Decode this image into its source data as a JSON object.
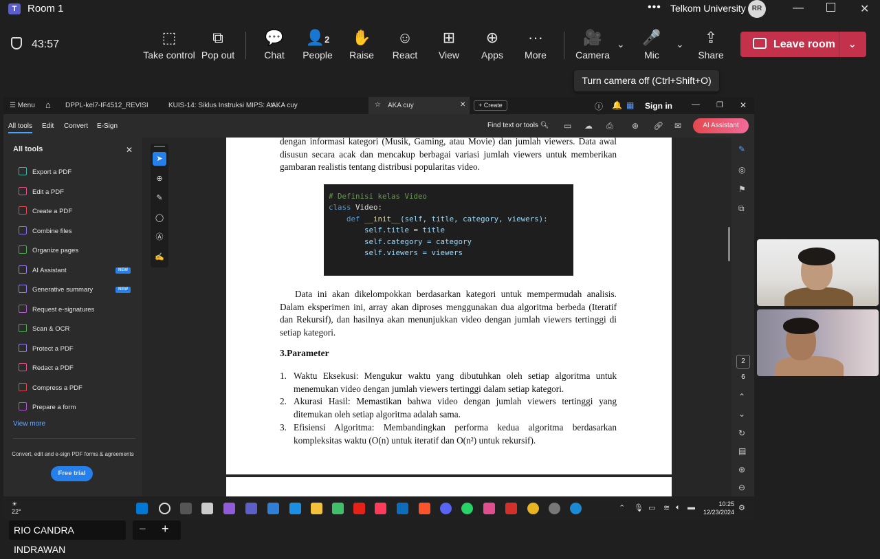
{
  "teams": {
    "window_title": "Room 1",
    "org_name": "Telkom University",
    "avatar_initials": "RR",
    "timer": "43:57",
    "toolbar": {
      "take_control": "Take control",
      "pop_out": "Pop out",
      "chat": "Chat",
      "people": "People",
      "people_count": "2",
      "raise": "Raise",
      "react": "React",
      "view": "View",
      "apps": "Apps",
      "more": "More",
      "camera": "Camera",
      "mic": "Mic",
      "share": "Share",
      "leave": "Leave room"
    },
    "tooltip": "Turn camera off (Ctrl+Shift+O)",
    "presenter_name": "RIO CANDRA INDRAWAN",
    "zoom_minus": "−",
    "zoom_plus": "+"
  },
  "acrobat": {
    "menu_label": "Menu",
    "tabs": [
      "DPPL-kel7-IF4512_REVISI",
      "KUIS-14: Siklus Instruksi MIPS: At...",
      "AKA cuy"
    ],
    "active_tab": "AKA cuy",
    "create_label": "+ Create",
    "sign_in": "Sign in",
    "menubar": {
      "all_tools": "All tools",
      "edit": "Edit",
      "convert": "Convert",
      "esign": "E-Sign",
      "find": "Find text or tools",
      "ai_assistant": "AI Assistant"
    },
    "panel": {
      "title": "All tools",
      "items": [
        {
          "label": "Export a PDF",
          "color": "#3fb8a7"
        },
        {
          "label": "Edit a PDF",
          "color": "#e8508c"
        },
        {
          "label": "Create a PDF",
          "color": "#e5484d"
        },
        {
          "label": "Combine files",
          "color": "#8c6cf0"
        },
        {
          "label": "Organize pages",
          "color": "#4caf50"
        },
        {
          "label": "AI Assistant",
          "color": "#9c7cf4",
          "badge": "NEW"
        },
        {
          "label": "Generative summary",
          "color": "#9c7cf4",
          "badge": "NEW"
        },
        {
          "label": "Request e-signatures",
          "color": "#b455d6"
        },
        {
          "label": "Scan & OCR",
          "color": "#4caf50"
        },
        {
          "label": "Protect a PDF",
          "color": "#9c7cf4"
        },
        {
          "label": "Redact a PDF",
          "color": "#e8508c"
        },
        {
          "label": "Compress a PDF",
          "color": "#e5484d"
        },
        {
          "label": "Prepare a form",
          "color": "#b455d6"
        }
      ],
      "view_more": "View more",
      "promo": "Convert, edit and e-sign PDF forms & agreements",
      "free_trial": "Free trial"
    },
    "document": {
      "intro_paragraph": "dengan informasi kategori (Musik, Gaming, atau Movie) dan jumlah viewers. Data awal disusun secara acak dan mencakup berbagai variasi jumlah viewers untuk memberikan gambaran realistis tentang distribusi popularitas video.",
      "code": {
        "comment": "# Definisi kelas Video",
        "line2_kw": "class",
        "line2_rest": " Video:",
        "line3_kw": "def",
        "line3_fn": "__init__",
        "line3_args": "(self, title, category, viewers):",
        "line4": "self.title = title",
        "line5": "self.category = category",
        "line6": "self.viewers = viewers"
      },
      "paragraph2": "Data ini akan dikelompokkan berdasarkan kategori untuk mempermudah analisis. Dalam eksperimen ini, array akan diproses menggunakan dua algoritma berbeda (Iteratif dan Rekursif), dan hasilnya akan menunjukkan video dengan jumlah viewers tertinggi di setiap kategori.",
      "heading": "3.Parameter",
      "list": [
        {
          "num": "1.",
          "text": "Waktu Eksekusi: Mengukur waktu yang dibutuhkan oleh setiap algoritma untuk menemukan video dengan jumlah viewers tertinggi dalam setiap kategori."
        },
        {
          "num": "2.",
          "text": "Akurasi Hasil: Memastikan bahwa video dengan jumlah viewers tertinggi yang ditemukan oleh setiap algoritma adalah sama."
        },
        {
          "num": "3.",
          "text": "Efisiensi Algoritma: Membandingkan performa kedua algoritma berdasarkan kompleksitas waktu (O(n) untuk iteratif dan O(n²) untuk rekursif)."
        }
      ]
    },
    "page_current": "2",
    "page_total": "6"
  },
  "taskbar": {
    "weather": "22°",
    "time": "10:25",
    "date": "12/23/2024"
  }
}
